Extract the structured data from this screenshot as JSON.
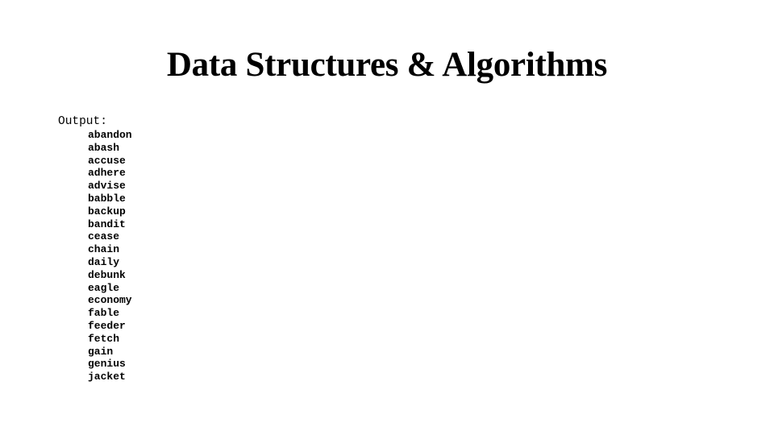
{
  "slide": {
    "title": "Data Structures & Algorithms",
    "output_label": "Output:",
    "words": [
      "abandon",
      "abash",
      "accuse",
      "adhere",
      "advise",
      "babble",
      "backup",
      "bandit",
      "cease",
      "chain",
      "daily",
      "debunk",
      "eagle",
      "economy",
      "fable",
      "feeder",
      "fetch",
      "gain",
      "genius",
      "jacket"
    ]
  }
}
